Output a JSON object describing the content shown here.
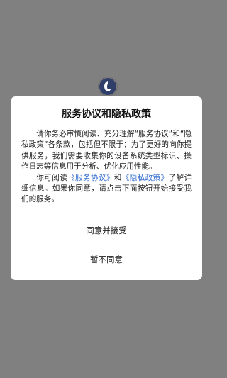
{
  "splash": {
    "logo_icon": "app-logo-icon"
  },
  "dialog": {
    "title": "服务协议和隐私政策",
    "paragraph1": "请你务必审慎阅读、充分理解“服务协议”和“隐私政策”各条款，包括但不限于：为了更好的向你提供服务，我们需要收集你的设备系统类型标识、操作日志等信息用于分析、优化应用性能。",
    "paragraph2_prefix": "你可阅读",
    "link_service": "《服务协议》",
    "paragraph2_and": "和",
    "link_privacy": "《隐私政策》",
    "paragraph2_suffix": "了解详细信息。如果你同意，请点击下面按钮开始接受我们的服务。",
    "agree_label": "同意并接受",
    "disagree_label": "暂不同意"
  },
  "colors": {
    "overlay": "#808080",
    "dialog_bg": "#ffffff",
    "link": "#2f6ad0"
  }
}
